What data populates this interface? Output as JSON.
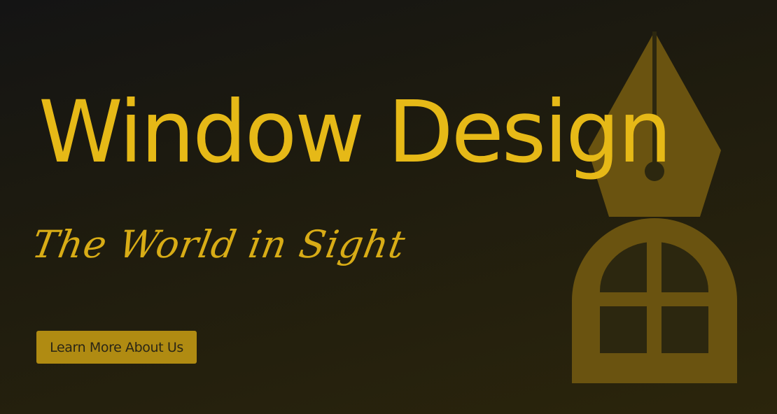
{
  "hero": {
    "title": "Window Design",
    "tagline": "The World in Sight",
    "cta_label": "Learn More About Us"
  },
  "icons": {
    "emblem": "pen-nib-window-icon"
  },
  "colors": {
    "accent": "#e6b917",
    "button_bg": "#b08b12",
    "emblem": "#6a5310",
    "background_dark": "#141414",
    "background_warm": "#2b250c"
  }
}
